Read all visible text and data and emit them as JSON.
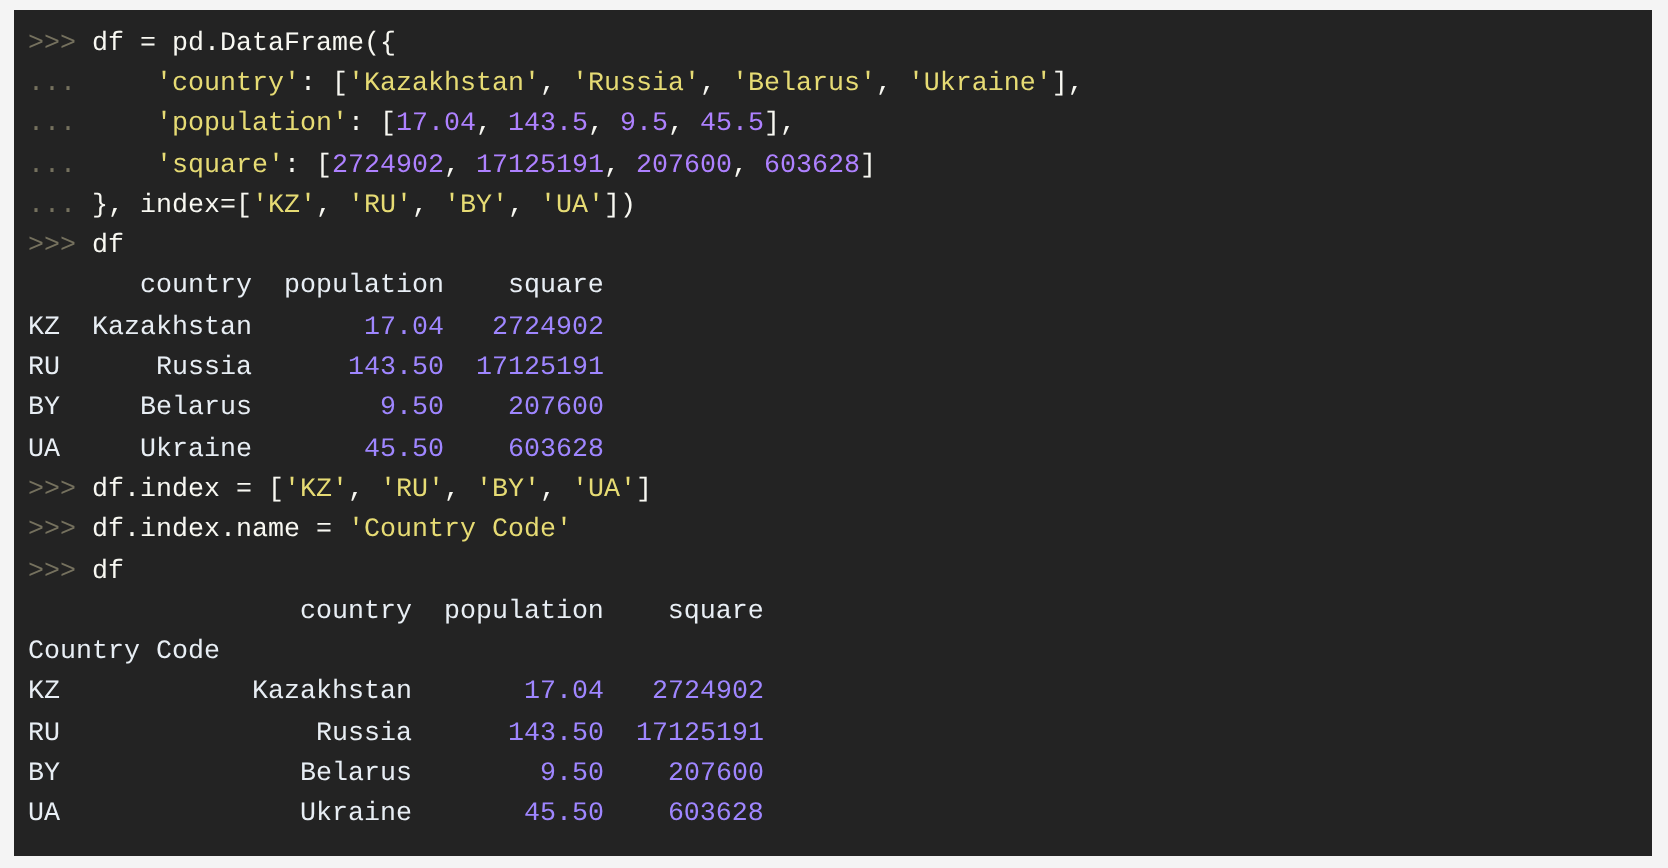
{
  "lines": [
    {
      "kind": "input",
      "prompt": ">>>",
      "tokens": [
        {
          "kind": "plain",
          "text": "df = pd.DataFrame({"
        }
      ]
    },
    {
      "kind": "input",
      "prompt": "...",
      "tokens": [
        {
          "kind": "string",
          "text": "    'country'"
        },
        {
          "kind": "plain",
          "text": ": ["
        },
        {
          "kind": "string",
          "text": "'Kazakhstan'"
        },
        {
          "kind": "plain",
          "text": ", "
        },
        {
          "kind": "string",
          "text": "'Russia'"
        },
        {
          "kind": "plain",
          "text": ", "
        },
        {
          "kind": "string",
          "text": "'Belarus'"
        },
        {
          "kind": "plain",
          "text": ", "
        },
        {
          "kind": "string",
          "text": "'Ukraine'"
        },
        {
          "kind": "plain",
          "text": "],"
        }
      ]
    },
    {
      "kind": "input",
      "prompt": "...",
      "tokens": [
        {
          "kind": "string",
          "text": "    'population'"
        },
        {
          "kind": "plain",
          "text": ": ["
        },
        {
          "kind": "number",
          "text": "17.04"
        },
        {
          "kind": "plain",
          "text": ", "
        },
        {
          "kind": "number",
          "text": "143.5"
        },
        {
          "kind": "plain",
          "text": ", "
        },
        {
          "kind": "number",
          "text": "9.5"
        },
        {
          "kind": "plain",
          "text": ", "
        },
        {
          "kind": "number",
          "text": "45.5"
        },
        {
          "kind": "plain",
          "text": "],"
        }
      ]
    },
    {
      "kind": "input",
      "prompt": "...",
      "tokens": [
        {
          "kind": "string",
          "text": "    'square'"
        },
        {
          "kind": "plain",
          "text": ": ["
        },
        {
          "kind": "number",
          "text": "2724902"
        },
        {
          "kind": "plain",
          "text": ", "
        },
        {
          "kind": "number",
          "text": "17125191"
        },
        {
          "kind": "plain",
          "text": ", "
        },
        {
          "kind": "number",
          "text": "207600"
        },
        {
          "kind": "plain",
          "text": ", "
        },
        {
          "kind": "number",
          "text": "603628"
        },
        {
          "kind": "plain",
          "text": "]"
        }
      ]
    },
    {
      "kind": "input",
      "prompt": "...",
      "tokens": [
        {
          "kind": "plain",
          "text": "}, index=["
        },
        {
          "kind": "string",
          "text": "'KZ'"
        },
        {
          "kind": "plain",
          "text": ", "
        },
        {
          "kind": "string",
          "text": "'RU'"
        },
        {
          "kind": "plain",
          "text": ", "
        },
        {
          "kind": "string",
          "text": "'BY'"
        },
        {
          "kind": "plain",
          "text": ", "
        },
        {
          "kind": "string",
          "text": "'UA'"
        },
        {
          "kind": "plain",
          "text": "])"
        }
      ]
    },
    {
      "kind": "input",
      "prompt": ">>>",
      "tokens": [
        {
          "kind": "plain",
          "text": "df"
        }
      ]
    },
    {
      "kind": "output",
      "tokens": [
        {
          "kind": "plain",
          "text": "       country  population    square"
        }
      ]
    },
    {
      "kind": "output",
      "tokens": [
        {
          "kind": "plain",
          "text": "KZ  Kazakhstan       "
        },
        {
          "kind": "number",
          "text": "17.04   "
        },
        {
          "kind": "number",
          "text": "2724902"
        }
      ]
    },
    {
      "kind": "output",
      "tokens": [
        {
          "kind": "plain",
          "text": "RU      Russia      "
        },
        {
          "kind": "number",
          "text": "143.50  "
        },
        {
          "kind": "number",
          "text": "17125191"
        }
      ]
    },
    {
      "kind": "output",
      "tokens": [
        {
          "kind": "plain",
          "text": "BY     Belarus        "
        },
        {
          "kind": "number",
          "text": "9.50    "
        },
        {
          "kind": "number",
          "text": "207600"
        }
      ]
    },
    {
      "kind": "output",
      "tokens": [
        {
          "kind": "plain",
          "text": "UA     Ukraine       "
        },
        {
          "kind": "number",
          "text": "45.50    "
        },
        {
          "kind": "number",
          "text": "603628"
        }
      ]
    },
    {
      "kind": "input",
      "prompt": ">>>",
      "tokens": [
        {
          "kind": "plain",
          "text": "df.index = ["
        },
        {
          "kind": "string",
          "text": "'KZ'"
        },
        {
          "kind": "plain",
          "text": ", "
        },
        {
          "kind": "string",
          "text": "'RU'"
        },
        {
          "kind": "plain",
          "text": ", "
        },
        {
          "kind": "string",
          "text": "'BY'"
        },
        {
          "kind": "plain",
          "text": ", "
        },
        {
          "kind": "string",
          "text": "'UA'"
        },
        {
          "kind": "plain",
          "text": "]"
        }
      ]
    },
    {
      "kind": "input",
      "prompt": ">>>",
      "tokens": [
        {
          "kind": "plain",
          "text": "df.index.name = "
        },
        {
          "kind": "string",
          "text": "'Country Code'"
        }
      ]
    },
    {
      "kind": "input",
      "prompt": ">>>",
      "tokens": [
        {
          "kind": "plain",
          "text": "df"
        }
      ]
    },
    {
      "kind": "output",
      "tokens": [
        {
          "kind": "plain",
          "text": "                 country  population    square"
        }
      ]
    },
    {
      "kind": "output",
      "tokens": [
        {
          "kind": "plain",
          "text": "Country Code"
        }
      ]
    },
    {
      "kind": "output",
      "tokens": [
        {
          "kind": "plain",
          "text": "KZ            Kazakhstan       "
        },
        {
          "kind": "number",
          "text": "17.04   "
        },
        {
          "kind": "number",
          "text": "2724902"
        }
      ]
    },
    {
      "kind": "output",
      "tokens": [
        {
          "kind": "plain",
          "text": "RU                Russia      "
        },
        {
          "kind": "number",
          "text": "143.50  "
        },
        {
          "kind": "number",
          "text": "17125191"
        }
      ]
    },
    {
      "kind": "output",
      "tokens": [
        {
          "kind": "plain",
          "text": "BY               Belarus        "
        },
        {
          "kind": "number",
          "text": "9.50    "
        },
        {
          "kind": "number",
          "text": "207600"
        }
      ]
    },
    {
      "kind": "output",
      "tokens": [
        {
          "kind": "plain",
          "text": "UA               Ukraine       "
        },
        {
          "kind": "number",
          "text": "45.50    "
        },
        {
          "kind": "number",
          "text": "603628"
        }
      ]
    }
  ]
}
